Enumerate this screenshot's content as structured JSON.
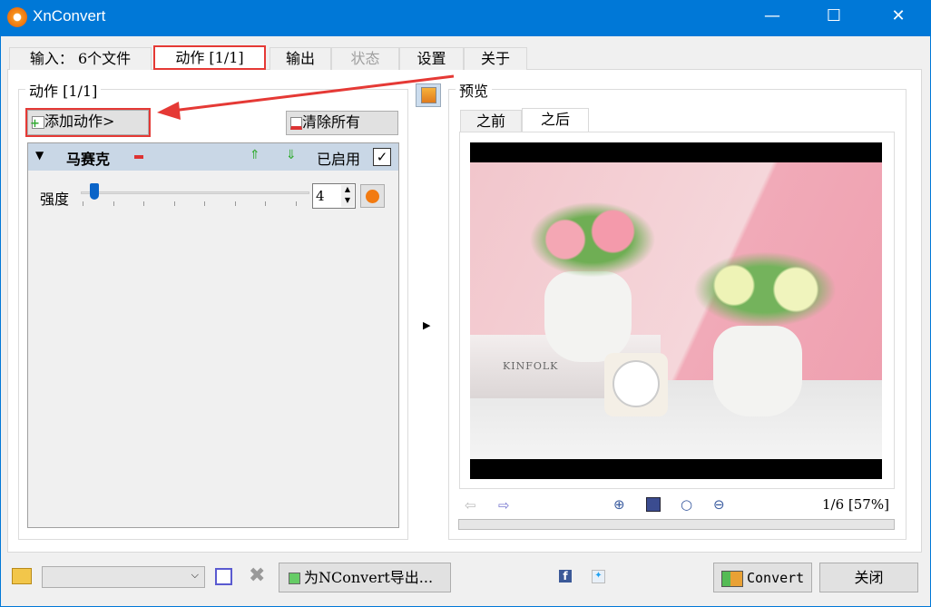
{
  "window": {
    "title": "XnConvert",
    "minimize": "—",
    "maximize": "☐",
    "close": "✕"
  },
  "tabs": [
    {
      "label": "输入：  6个文件"
    },
    {
      "label": "动作 [1/1]"
    },
    {
      "label": "输出"
    },
    {
      "label": "状态"
    },
    {
      "label": "设置"
    },
    {
      "label": "关于"
    }
  ],
  "actions": {
    "group_label": "动作 [1/1]",
    "add_action": "添加动作>",
    "clear_all": "清除所有",
    "item": {
      "name": "马赛克",
      "enabled_label": "已启用",
      "enabled": true,
      "param_label": "强度",
      "param_value": "4",
      "slider_fraction": 0.03
    }
  },
  "preview": {
    "group_label": "预览",
    "tabs": [
      {
        "label": "之前"
      },
      {
        "label": "之后"
      }
    ],
    "page_info": "1/6 [57%]",
    "image_text": "KINFOLK"
  },
  "bottom": {
    "export_button": "为NConvert导出...",
    "convert_button": "Convert",
    "close_button": "关闭",
    "preset_value": ""
  },
  "colors": {
    "titlebar": "#0078d7",
    "highlight": "#e53935"
  }
}
